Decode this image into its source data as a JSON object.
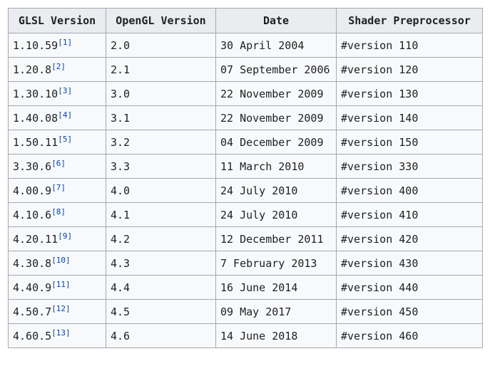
{
  "table": {
    "headers": [
      "GLSL Version",
      "OpenGL Version",
      "Date",
      "Shader Preprocessor"
    ],
    "rows": [
      {
        "glsl": "1.10.59",
        "ref": "[1]",
        "opengl": "2.0",
        "date": "30 April 2004",
        "preprocessor": "#version 110"
      },
      {
        "glsl": "1.20.8",
        "ref": "[2]",
        "opengl": "2.1",
        "date": "07 September 2006",
        "preprocessor": "#version 120"
      },
      {
        "glsl": "1.30.10",
        "ref": "[3]",
        "opengl": "3.0",
        "date": "22 November 2009",
        "preprocessor": "#version 130"
      },
      {
        "glsl": "1.40.08",
        "ref": "[4]",
        "opengl": "3.1",
        "date": "22 November 2009",
        "preprocessor": "#version 140"
      },
      {
        "glsl": "1.50.11",
        "ref": "[5]",
        "opengl": "3.2",
        "date": "04 December 2009",
        "preprocessor": "#version 150"
      },
      {
        "glsl": "3.30.6",
        "ref": "[6]",
        "opengl": "3.3",
        "date": "11 March 2010",
        "preprocessor": "#version 330"
      },
      {
        "glsl": "4.00.9",
        "ref": "[7]",
        "opengl": "4.0",
        "date": "24 July 2010",
        "preprocessor": "#version 400"
      },
      {
        "glsl": "4.10.6",
        "ref": "[8]",
        "opengl": "4.1",
        "date": "24 July 2010",
        "preprocessor": "#version 410"
      },
      {
        "glsl": "4.20.11",
        "ref": "[9]",
        "opengl": "4.2",
        "date": "12 December 2011",
        "preprocessor": "#version 420"
      },
      {
        "glsl": "4.30.8",
        "ref": "[10]",
        "opengl": "4.3",
        "date": "7 February 2013",
        "preprocessor": "#version 430"
      },
      {
        "glsl": "4.40.9",
        "ref": "[11]",
        "opengl": "4.4",
        "date": "16 June 2014",
        "preprocessor": "#version 440"
      },
      {
        "glsl": "4.50.7",
        "ref": "[12]",
        "opengl": "4.5",
        "date": "09 May 2017",
        "preprocessor": "#version 450"
      },
      {
        "glsl": "4.60.5",
        "ref": "[13]",
        "opengl": "4.6",
        "date": "14 June 2018",
        "preprocessor": "#version 460"
      }
    ]
  },
  "colors": {
    "header_bg": "#eaecf0",
    "cell_bg": "#f8f9fa",
    "border": "#a2a9b1",
    "text": "#202122",
    "link": "#0645ad"
  }
}
